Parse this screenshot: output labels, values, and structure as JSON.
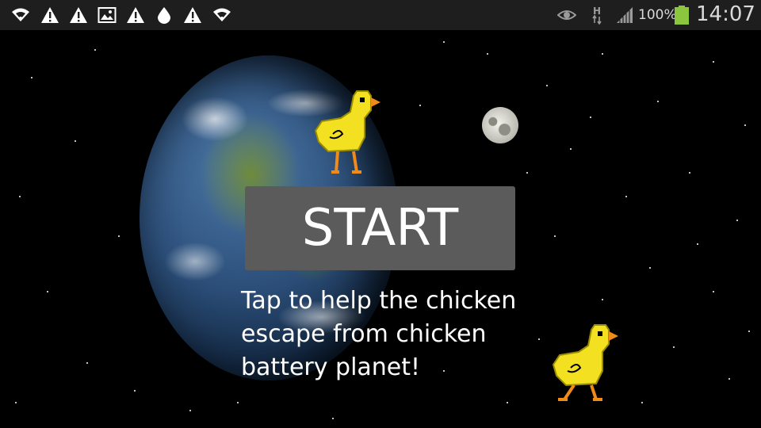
{
  "status_bar": {
    "left_icons": [
      "wifi-icon",
      "warning-icon",
      "warning-icon",
      "image-icon",
      "warning-icon",
      "drop-icon",
      "warning-icon",
      "wifi-icon"
    ],
    "right_icons": [
      "eye-icon",
      "hspa-network-icon",
      "signal-icon",
      "battery-icon"
    ],
    "network_type": "H",
    "battery_percent": "100%",
    "time": "14:07",
    "battery_color": "#8cc63f"
  },
  "game": {
    "start_label": "START",
    "tagline_lines": [
      "Tap to help the chicken",
      "escape from chicken",
      "battery planet!"
    ],
    "colors": {
      "background": "#000000",
      "button": "#5b5b5c",
      "button_text": "#ffffff",
      "chicken_body": "#f3e020",
      "chicken_beak": "#f08a18"
    }
  }
}
